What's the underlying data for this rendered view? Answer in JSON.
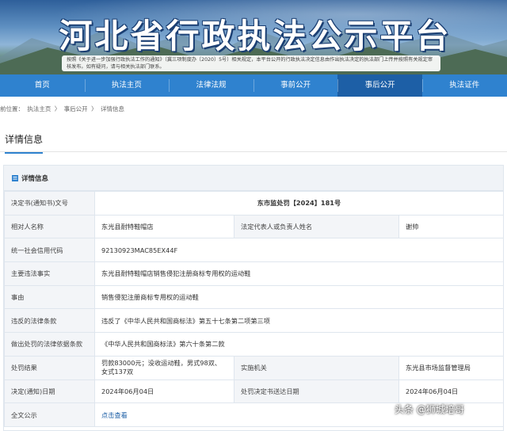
{
  "banner": {
    "title": "河北省行政执法公示平台",
    "notice": "按照《关于进一步加强行政执法工作的通知》（冀三项制度办〔2020〕5号）相关规定，本平台公开的行政执法决定信息由作出执法决定的执法部门上传并按照有关规定审核发布。如有疑问，请与相关执法部门联系。"
  },
  "nav": {
    "items": [
      "首页",
      "执法主页",
      "法律法规",
      "事前公开",
      "事后公开",
      "执法证件"
    ],
    "active_index": 4
  },
  "breadcrumb": {
    "items": [
      "前位置：",
      "执法主页",
      "〉",
      "事后公开",
      "〉",
      "详情信息"
    ]
  },
  "section": {
    "title": "详情信息"
  },
  "panel": {
    "title": "详情信息"
  },
  "details": {
    "decision_no_label": "决定书(通知书)文号",
    "decision_no": "东市监处罚【2024】181号",
    "party_label": "相对人名称",
    "party": "东光县耐特鞋帽店",
    "legal_rep_label": "法定代表人或负责人姓名",
    "legal_rep": "谢帅",
    "credit_code_label": "统一社会信用代码",
    "credit_code": "92130923MAC85EX44F",
    "facts_label": "主要违法事实",
    "facts": "东光县耐特鞋帽店销售侵犯注册商标专用权的运动鞋",
    "cause_label": "事由",
    "cause": "销售侵犯注册商标专用权的运动鞋",
    "violated_label": "违反的法律条款",
    "violated": "违反了《中华人民共和国商标法》第五十七条第二项第三项",
    "basis_label": "做出处罚的法律依据条款",
    "basis": "《中华人民共和国商标法》第六十条第二款",
    "result_label": "处罚结果",
    "result": "罚款83000元；没收运动鞋，男式98双、女式137双",
    "agency_label": "实施机关",
    "agency": "东光县市场监督管理局",
    "decision_date_label": "决定(通知)日期",
    "decision_date": "2024年06月04日",
    "delivery_date_label": "处罚决定书送达日期",
    "delivery_date": "2024年06月04日",
    "fulltext_label": "全文公示",
    "fulltext_link": "点击查看"
  },
  "watermark": "头条 @狮城培哥"
}
